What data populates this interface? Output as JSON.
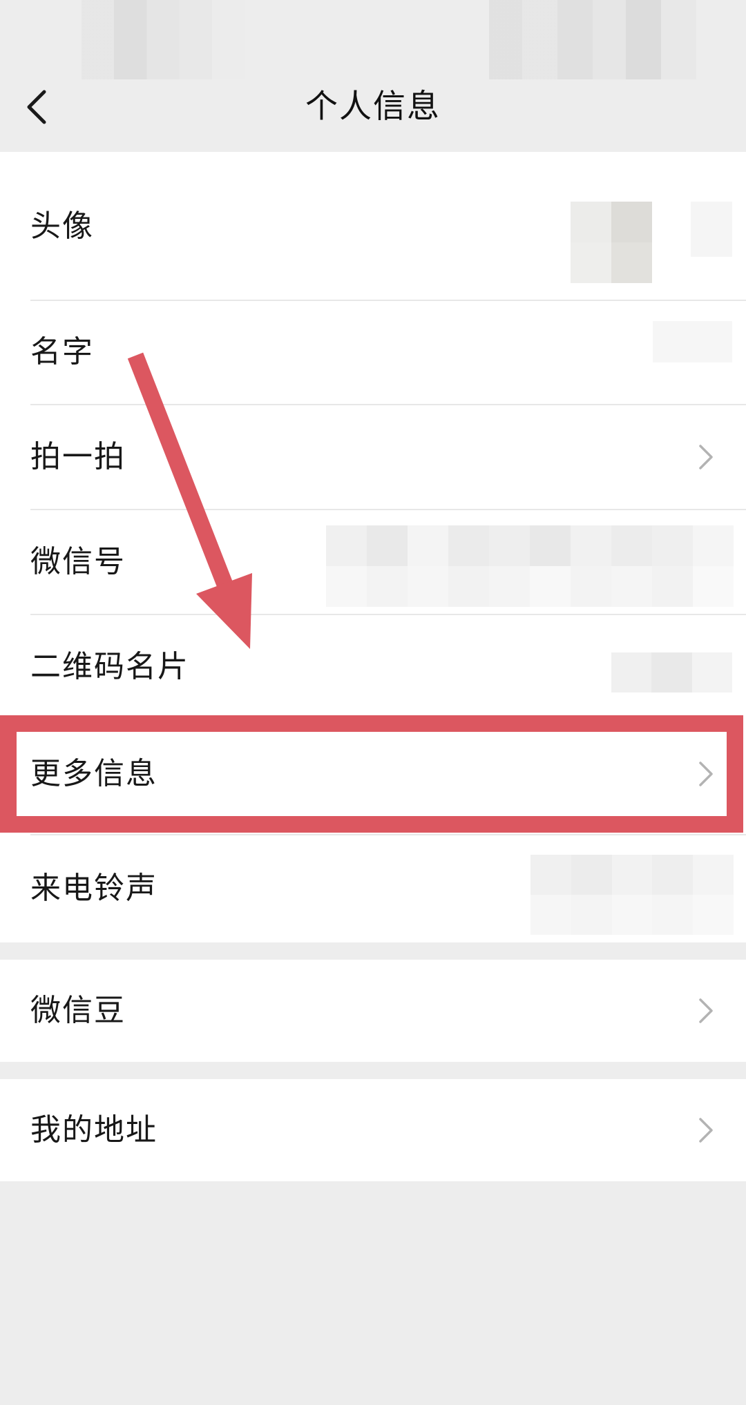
{
  "header": {
    "title": "个人信息",
    "back_icon": "chevron-left-icon"
  },
  "profile": {
    "rows": [
      {
        "label": "头像"
      },
      {
        "label": "名字"
      },
      {
        "label": "拍一拍"
      },
      {
        "label": "微信号"
      },
      {
        "label": "二维码名片"
      },
      {
        "label": "更多信息"
      },
      {
        "label": "来电铃声"
      }
    ]
  },
  "wallet": {
    "label": "微信豆"
  },
  "address": {
    "label": "我的地址"
  },
  "annotation": {
    "color": "#dc5760",
    "highlighted_row": "更多信息"
  },
  "colors": {
    "background": "#ededed",
    "card": "#ffffff",
    "text": "#181818"
  }
}
